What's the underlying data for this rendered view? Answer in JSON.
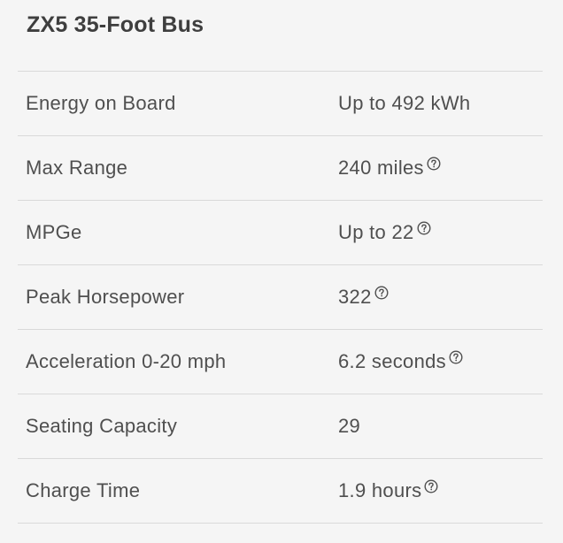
{
  "title": "ZX5 35-Foot Bus",
  "specs": [
    {
      "label": "Energy on Board",
      "value": "Up to 492 kWh",
      "info": false
    },
    {
      "label": "Max Range",
      "value": "240 miles",
      "info": true
    },
    {
      "label": "MPGe",
      "value": "Up to 22",
      "info": true
    },
    {
      "label": "Peak Horsepower",
      "value": "322",
      "info": true
    },
    {
      "label": "Acceleration 0-20 mph",
      "value": "6.2 seconds",
      "info": true
    },
    {
      "label": "Seating Capacity",
      "value": "29",
      "info": false
    },
    {
      "label": "Charge Time",
      "value": "1.9 hours",
      "info": true
    }
  ],
  "icons": {
    "info": "question-circle-icon"
  },
  "colors": {
    "background": "#f5f5f5",
    "text": "#4f4f4f",
    "title": "#3e3e3e",
    "divider": "#d9d9d9"
  }
}
